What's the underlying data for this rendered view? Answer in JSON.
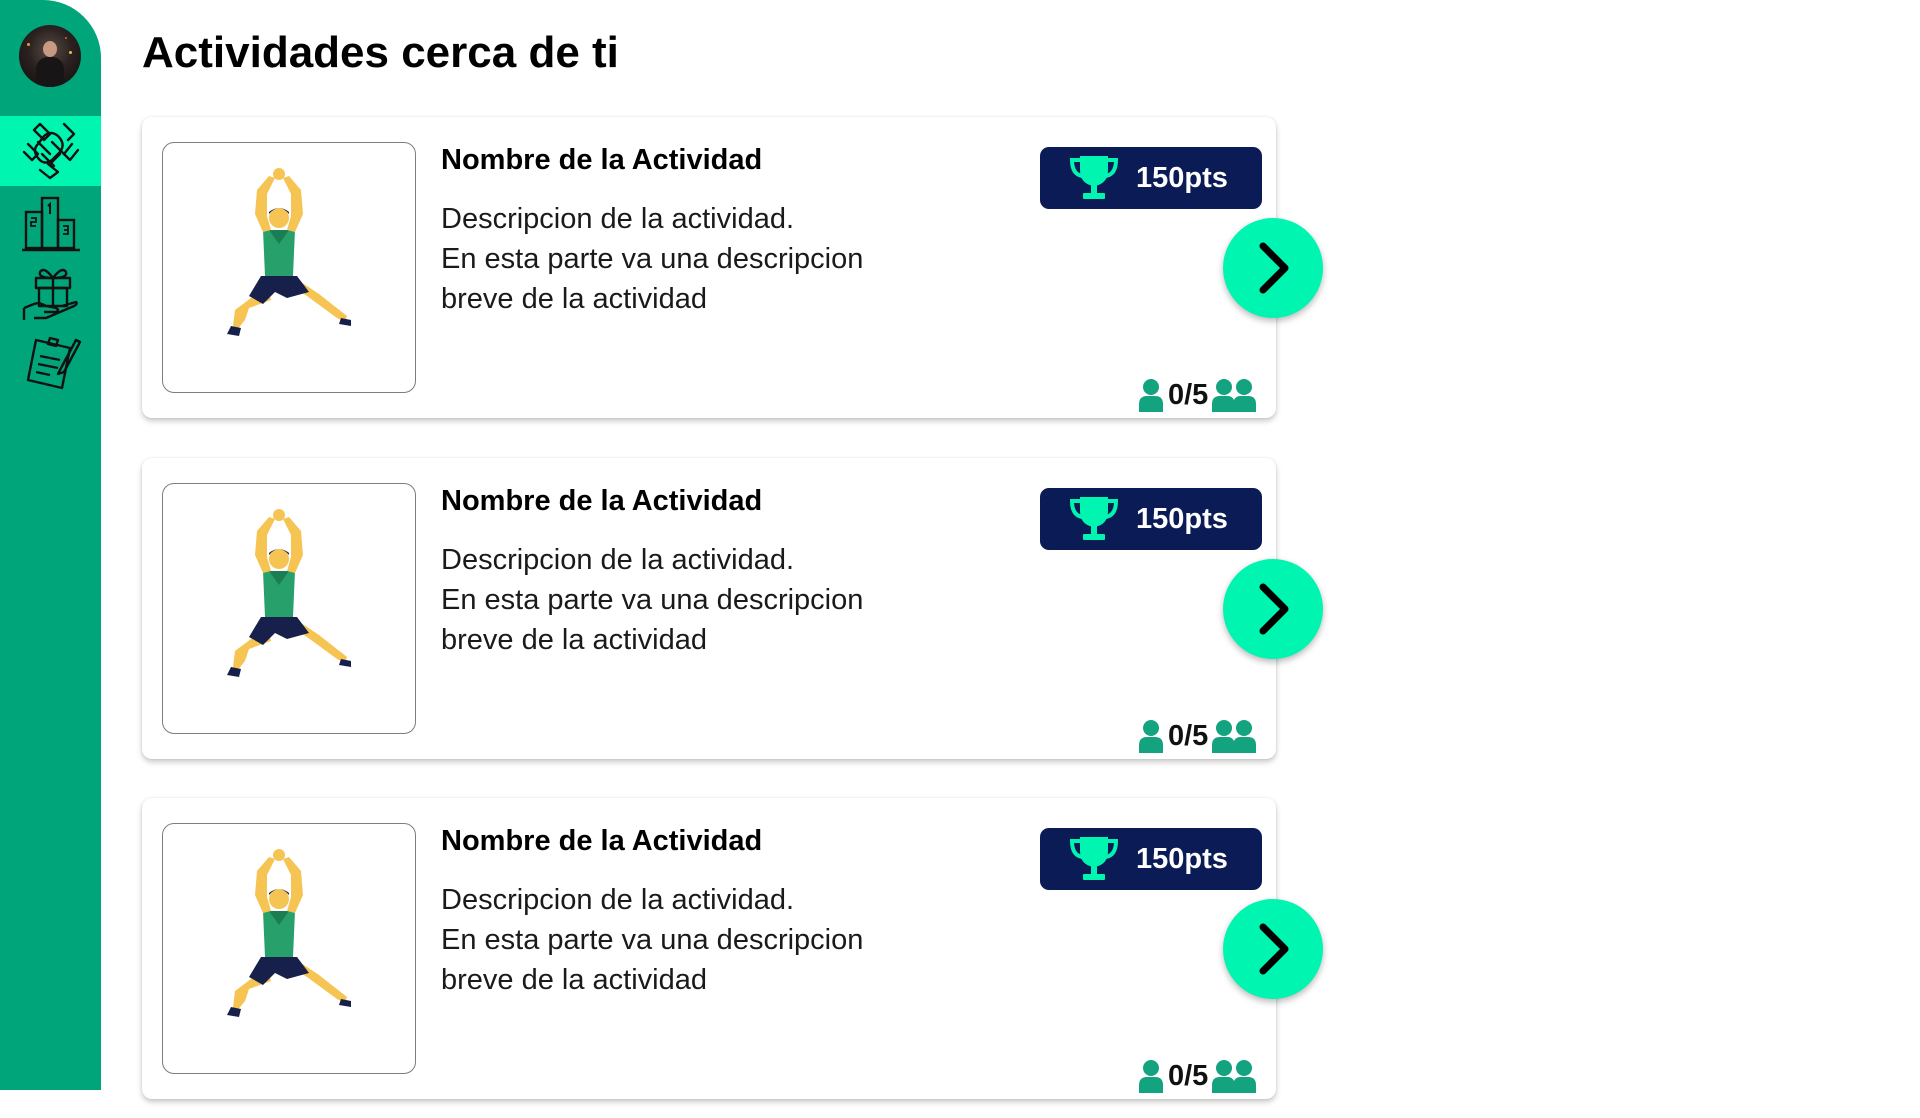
{
  "page": {
    "title": "Actividades cerca de ti"
  },
  "sidebar": {
    "avatar": "user-avatar",
    "items": [
      {
        "name": "activities",
        "icon": "hands-together-icon",
        "active": true
      },
      {
        "name": "ranking",
        "icon": "podium-icon",
        "active": false
      },
      {
        "name": "rewards",
        "icon": "gift-hand-icon",
        "active": false
      },
      {
        "name": "notes",
        "icon": "clipboard-icon",
        "active": false
      }
    ]
  },
  "activities": [
    {
      "title": "Nombre de la Actividad",
      "description": [
        "Descripcion de la actividad.",
        "En esta parte va una descripcion",
        "breve de la actividad"
      ],
      "points": "150pts",
      "participants": "0/5",
      "image": "stretching-athlete-illustration"
    },
    {
      "title": "Nombre de la Actividad",
      "description": [
        "Descripcion de la actividad.",
        "En esta parte va una descripcion",
        "breve de la actividad"
      ],
      "points": "150pts",
      "participants": "0/5",
      "image": "stretching-athlete-illustration"
    },
    {
      "title": "Nombre de la Actividad",
      "description": [
        "Descripcion de la actividad.",
        "En esta parte va una descripcion",
        "breve de la actividad"
      ],
      "points": "150pts",
      "participants": "0/5",
      "image": "stretching-athlete-illustration"
    }
  ],
  "colors": {
    "sidebar": "#00a67a",
    "accent": "#00f5b0",
    "badge": "#0b1b55",
    "people_icon": "#14a37f"
  }
}
